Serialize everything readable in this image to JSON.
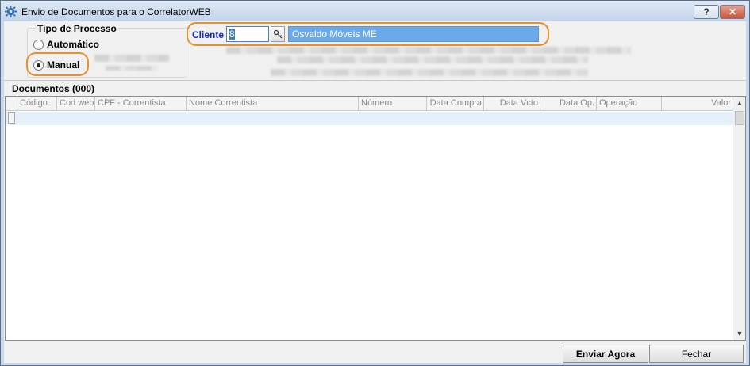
{
  "window": {
    "title": "Envio de Documentos para o CorrelatorWEB",
    "help_label": "?",
    "close_label": "✕"
  },
  "process_type": {
    "legend": "Tipo de Processo",
    "options": [
      {
        "label": "Automático",
        "selected": false
      },
      {
        "label": "Manual",
        "selected": true
      }
    ]
  },
  "client": {
    "label": "Cliente",
    "code": "8",
    "name": "Osvaldo Móveis ME",
    "lookup_icon": "key-icon"
  },
  "documents": {
    "title": "Documentos (000)",
    "columns": [
      "Código",
      "Cod web",
      "CPF - Correntista",
      "Nome Correntista",
      "Número",
      "Data Compra",
      "Data Vcto",
      "Data Op.",
      "Operação",
      "Valor"
    ],
    "rows": []
  },
  "buttons": {
    "send": "Enviar Agora",
    "close": "Fechar"
  },
  "colors": {
    "highlight": "#e8902d",
    "client_label": "#1a2bb5",
    "client_name_bg": "#6aa9ea"
  }
}
